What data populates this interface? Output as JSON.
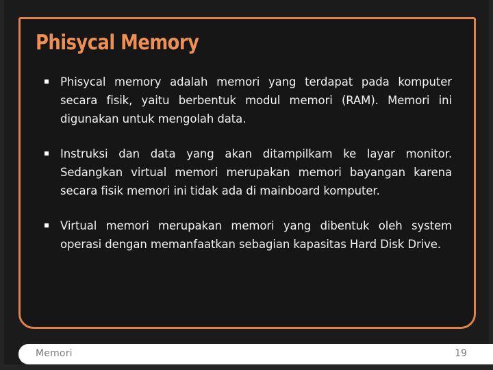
{
  "slide": {
    "title": "Phisycal Memory",
    "bullets": [
      {
        "marker": "square-bullet",
        "text": "Phisycal memory adalah memori yang terdapat pada komputer secara fisik, yaitu berbentuk modul memori (RAM). Memori ini digunakan untuk mengolah data."
      },
      {
        "marker": "square-bullet",
        "text": "Instruksi dan data yang akan ditampilkam ke layar monitor. Sedangkan virtual memori merupakan memori bayangan karena secara fisik memori ini tidak ada di mainboard komputer."
      },
      {
        "marker": "square-bullet",
        "text": "Virtual memori merupakan memori yang dibentuk oleh system operasi dengan memanfaatkan sebagian kapasitas Hard Disk Drive."
      }
    ],
    "footer": {
      "label": "Memori",
      "page_number": "19"
    },
    "colors": {
      "background": "#1b1b1b",
      "panel_background": "#161616",
      "accent_border": "#E0834A",
      "title_text": "#EE8F55",
      "body_text": "#F2F2F2",
      "footer_background": "#FFFFFF",
      "footer_text": "#7C7C7C"
    }
  }
}
